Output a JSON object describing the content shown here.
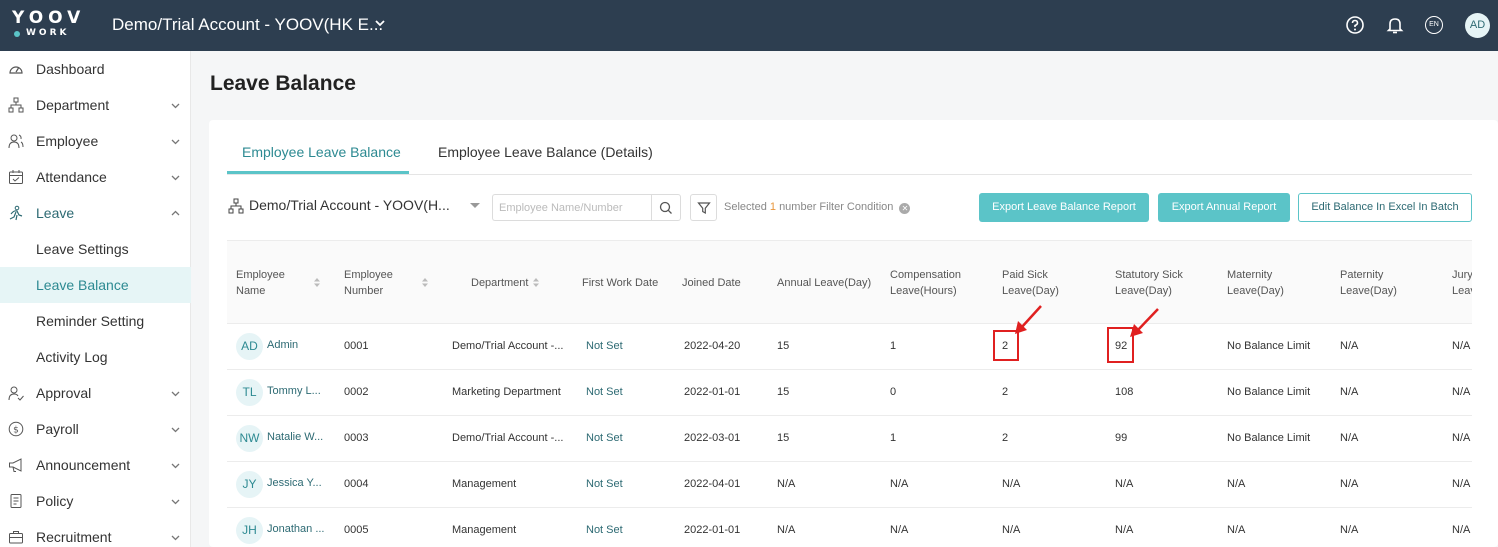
{
  "header": {
    "logo_main": "YOOV",
    "logo_sub": "WORK",
    "account_title": "Demo/Trial Account - YOOV(HK E...",
    "icons": [
      "help-circle-icon",
      "bell-icon",
      "language-icon"
    ],
    "language_label": "EN",
    "user_initials": "AD"
  },
  "sidebar": {
    "items": [
      {
        "label": "Dashboard",
        "icon": "dashboard-gauge-icon"
      },
      {
        "label": "Department",
        "icon": "org-chart-icon"
      },
      {
        "label": "Employee",
        "icon": "people-icon"
      },
      {
        "label": "Attendance",
        "icon": "calendar-check-icon"
      },
      {
        "label": "Leave",
        "icon": "leave-person-icon"
      },
      {
        "label": "Leave Settings"
      },
      {
        "label": "Leave Balance"
      },
      {
        "label": "Reminder Setting"
      },
      {
        "label": "Activity Log"
      },
      {
        "label": "Approval",
        "icon": "approval-person-icon"
      },
      {
        "label": "Payroll",
        "icon": "dollar-circle-icon"
      },
      {
        "label": "Announcement",
        "icon": "megaphone-icon"
      },
      {
        "label": "Policy",
        "icon": "document-icon"
      },
      {
        "label": "Recruitment",
        "icon": "briefcase-icon"
      }
    ]
  },
  "page": {
    "title": "Leave Balance"
  },
  "tabs": [
    {
      "label": "Employee Leave Balance",
      "active": true
    },
    {
      "label": "Employee Leave Balance (Details)",
      "active": false
    }
  ],
  "toolbar": {
    "org_selector": "Demo/Trial Account - YOOV(H...",
    "search_placeholder": "Employee Name/Number",
    "filter_prefix": "Selected",
    "filter_count": "1",
    "filter_suffix": "number Filter Condition",
    "export_balance_label": "Export Leave Balance Report",
    "export_annual_label": "Export Annual Report",
    "edit_batch_label": "Edit Balance In Excel In Batch"
  },
  "table": {
    "columns": [
      "Employee Name",
      "Employee Number",
      "Department",
      "First Work Date",
      "Joined Date",
      "Annual Leave(Day)",
      "Compensation Leave(Hours)",
      "Paid Sick Leave(Day)",
      "Statutory Sick Leave(Day)",
      "Maternity Leave(Day)",
      "Paternity Leave(Day)",
      "Jury Leave"
    ],
    "rows": [
      {
        "initials": "AD",
        "name": "Admin",
        "number": "0001",
        "department": "Demo/Trial Account -...",
        "first_work": "Not Set",
        "joined": "2022-04-20",
        "annual": "15",
        "compensation": "1",
        "paid_sick": "2",
        "statutory_sick": "92",
        "maternity": "No Balance Limit",
        "paternity": "N/A",
        "jury": "N/A"
      },
      {
        "initials": "TL",
        "name": "Tommy L...",
        "number": "0002",
        "department": "Marketing Department",
        "first_work": "Not Set",
        "joined": "2022-01-01",
        "annual": "15",
        "compensation": "0",
        "paid_sick": "2",
        "statutory_sick": "108",
        "maternity": "No Balance Limit",
        "paternity": "N/A",
        "jury": "N/A"
      },
      {
        "initials": "NW",
        "name": "Natalie W...",
        "number": "0003",
        "department": "Demo/Trial Account -...",
        "first_work": "Not Set",
        "joined": "2022-03-01",
        "annual": "15",
        "compensation": "1",
        "paid_sick": "2",
        "statutory_sick": "99",
        "maternity": "No Balance Limit",
        "paternity": "N/A",
        "jury": "N/A"
      },
      {
        "initials": "JY",
        "name": "Jessica Y...",
        "number": "0004",
        "department": "Management",
        "first_work": "Not Set",
        "joined": "2022-04-01",
        "annual": "N/A",
        "compensation": "N/A",
        "paid_sick": "N/A",
        "statutory_sick": "N/A",
        "maternity": "N/A",
        "paternity": "N/A",
        "jury": "N/A"
      },
      {
        "initials": "JH",
        "name": "Jonathan ...",
        "number": "0005",
        "department": "Management",
        "first_work": "Not Set",
        "joined": "2022-01-01",
        "annual": "N/A",
        "compensation": "N/A",
        "paid_sick": "N/A",
        "statutory_sick": "N/A",
        "maternity": "N/A",
        "paternity": "N/A",
        "jury": "N/A"
      }
    ]
  },
  "colors": {
    "topbar": "#2d3e50",
    "accent": "#5bc4c8",
    "annotation": "#e02020"
  }
}
